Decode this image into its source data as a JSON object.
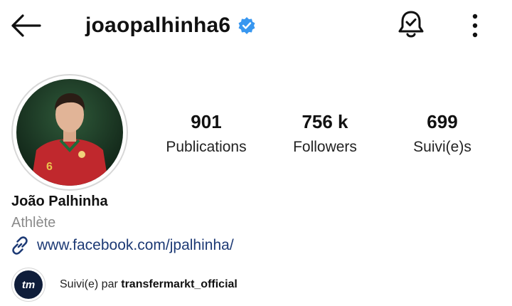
{
  "header": {
    "username": "joaopalhinha6",
    "verified_color": "#3897f0",
    "back_icon": "arrow-left-icon",
    "bell_icon": "bell-check-icon",
    "more_icon": "more-vertical-icon"
  },
  "stats": {
    "posts": {
      "value": "901",
      "label": "Publications"
    },
    "followers": {
      "value": "756 k",
      "label": "Followers"
    },
    "following": {
      "value": "699",
      "label": "Suivi(e)s"
    }
  },
  "profile": {
    "full_name": "João Palhinha",
    "category": "Athlète",
    "link": "www.facebook.com/jpalhinha/",
    "link_color": "#1d3a75"
  },
  "followed_by": {
    "avatar_text": "tm",
    "prefix": "Suivi(e) par ",
    "account": "transfermarkt_official"
  }
}
